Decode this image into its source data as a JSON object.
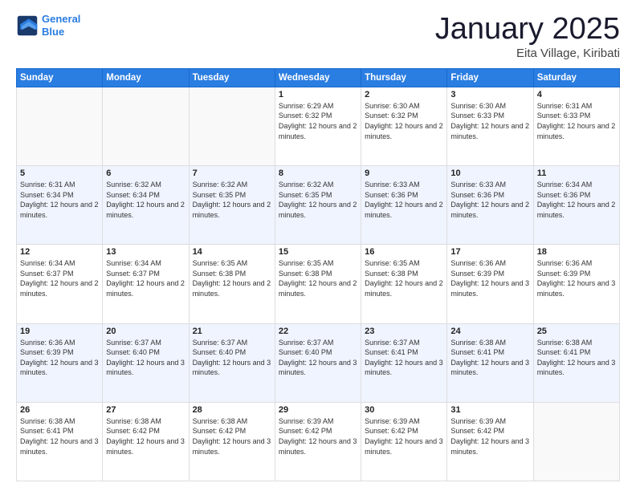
{
  "header": {
    "logo": {
      "line1": "General",
      "line2": "Blue"
    },
    "title": "January 2025",
    "subtitle": "Eita Village, Kiribati"
  },
  "days_of_week": [
    "Sunday",
    "Monday",
    "Tuesday",
    "Wednesday",
    "Thursday",
    "Friday",
    "Saturday"
  ],
  "weeks": [
    [
      {
        "day": "",
        "sunrise": "",
        "sunset": "",
        "daylight": ""
      },
      {
        "day": "",
        "sunrise": "",
        "sunset": "",
        "daylight": ""
      },
      {
        "day": "",
        "sunrise": "",
        "sunset": "",
        "daylight": ""
      },
      {
        "day": "1",
        "sunrise": "Sunrise: 6:29 AM",
        "sunset": "Sunset: 6:32 PM",
        "daylight": "Daylight: 12 hours and 2 minutes."
      },
      {
        "day": "2",
        "sunrise": "Sunrise: 6:30 AM",
        "sunset": "Sunset: 6:32 PM",
        "daylight": "Daylight: 12 hours and 2 minutes."
      },
      {
        "day": "3",
        "sunrise": "Sunrise: 6:30 AM",
        "sunset": "Sunset: 6:33 PM",
        "daylight": "Daylight: 12 hours and 2 minutes."
      },
      {
        "day": "4",
        "sunrise": "Sunrise: 6:31 AM",
        "sunset": "Sunset: 6:33 PM",
        "daylight": "Daylight: 12 hours and 2 minutes."
      }
    ],
    [
      {
        "day": "5",
        "sunrise": "Sunrise: 6:31 AM",
        "sunset": "Sunset: 6:34 PM",
        "daylight": "Daylight: 12 hours and 2 minutes."
      },
      {
        "day": "6",
        "sunrise": "Sunrise: 6:32 AM",
        "sunset": "Sunset: 6:34 PM",
        "daylight": "Daylight: 12 hours and 2 minutes."
      },
      {
        "day": "7",
        "sunrise": "Sunrise: 6:32 AM",
        "sunset": "Sunset: 6:35 PM",
        "daylight": "Daylight: 12 hours and 2 minutes."
      },
      {
        "day": "8",
        "sunrise": "Sunrise: 6:32 AM",
        "sunset": "Sunset: 6:35 PM",
        "daylight": "Daylight: 12 hours and 2 minutes."
      },
      {
        "day": "9",
        "sunrise": "Sunrise: 6:33 AM",
        "sunset": "Sunset: 6:36 PM",
        "daylight": "Daylight: 12 hours and 2 minutes."
      },
      {
        "day": "10",
        "sunrise": "Sunrise: 6:33 AM",
        "sunset": "Sunset: 6:36 PM",
        "daylight": "Daylight: 12 hours and 2 minutes."
      },
      {
        "day": "11",
        "sunrise": "Sunrise: 6:34 AM",
        "sunset": "Sunset: 6:36 PM",
        "daylight": "Daylight: 12 hours and 2 minutes."
      }
    ],
    [
      {
        "day": "12",
        "sunrise": "Sunrise: 6:34 AM",
        "sunset": "Sunset: 6:37 PM",
        "daylight": "Daylight: 12 hours and 2 minutes."
      },
      {
        "day": "13",
        "sunrise": "Sunrise: 6:34 AM",
        "sunset": "Sunset: 6:37 PM",
        "daylight": "Daylight: 12 hours and 2 minutes."
      },
      {
        "day": "14",
        "sunrise": "Sunrise: 6:35 AM",
        "sunset": "Sunset: 6:38 PM",
        "daylight": "Daylight: 12 hours and 2 minutes."
      },
      {
        "day": "15",
        "sunrise": "Sunrise: 6:35 AM",
        "sunset": "Sunset: 6:38 PM",
        "daylight": "Daylight: 12 hours and 2 minutes."
      },
      {
        "day": "16",
        "sunrise": "Sunrise: 6:35 AM",
        "sunset": "Sunset: 6:38 PM",
        "daylight": "Daylight: 12 hours and 2 minutes."
      },
      {
        "day": "17",
        "sunrise": "Sunrise: 6:36 AM",
        "sunset": "Sunset: 6:39 PM",
        "daylight": "Daylight: 12 hours and 3 minutes."
      },
      {
        "day": "18",
        "sunrise": "Sunrise: 6:36 AM",
        "sunset": "Sunset: 6:39 PM",
        "daylight": "Daylight: 12 hours and 3 minutes."
      }
    ],
    [
      {
        "day": "19",
        "sunrise": "Sunrise: 6:36 AM",
        "sunset": "Sunset: 6:39 PM",
        "daylight": "Daylight: 12 hours and 3 minutes."
      },
      {
        "day": "20",
        "sunrise": "Sunrise: 6:37 AM",
        "sunset": "Sunset: 6:40 PM",
        "daylight": "Daylight: 12 hours and 3 minutes."
      },
      {
        "day": "21",
        "sunrise": "Sunrise: 6:37 AM",
        "sunset": "Sunset: 6:40 PM",
        "daylight": "Daylight: 12 hours and 3 minutes."
      },
      {
        "day": "22",
        "sunrise": "Sunrise: 6:37 AM",
        "sunset": "Sunset: 6:40 PM",
        "daylight": "Daylight: 12 hours and 3 minutes."
      },
      {
        "day": "23",
        "sunrise": "Sunrise: 6:37 AM",
        "sunset": "Sunset: 6:41 PM",
        "daylight": "Daylight: 12 hours and 3 minutes."
      },
      {
        "day": "24",
        "sunrise": "Sunrise: 6:38 AM",
        "sunset": "Sunset: 6:41 PM",
        "daylight": "Daylight: 12 hours and 3 minutes."
      },
      {
        "day": "25",
        "sunrise": "Sunrise: 6:38 AM",
        "sunset": "Sunset: 6:41 PM",
        "daylight": "Daylight: 12 hours and 3 minutes."
      }
    ],
    [
      {
        "day": "26",
        "sunrise": "Sunrise: 6:38 AM",
        "sunset": "Sunset: 6:41 PM",
        "daylight": "Daylight: 12 hours and 3 minutes."
      },
      {
        "day": "27",
        "sunrise": "Sunrise: 6:38 AM",
        "sunset": "Sunset: 6:42 PM",
        "daylight": "Daylight: 12 hours and 3 minutes."
      },
      {
        "day": "28",
        "sunrise": "Sunrise: 6:38 AM",
        "sunset": "Sunset: 6:42 PM",
        "daylight": "Daylight: 12 hours and 3 minutes."
      },
      {
        "day": "29",
        "sunrise": "Sunrise: 6:39 AM",
        "sunset": "Sunset: 6:42 PM",
        "daylight": "Daylight: 12 hours and 3 minutes."
      },
      {
        "day": "30",
        "sunrise": "Sunrise: 6:39 AM",
        "sunset": "Sunset: 6:42 PM",
        "daylight": "Daylight: 12 hours and 3 minutes."
      },
      {
        "day": "31",
        "sunrise": "Sunrise: 6:39 AM",
        "sunset": "Sunset: 6:42 PM",
        "daylight": "Daylight: 12 hours and 3 minutes."
      },
      {
        "day": "",
        "sunrise": "",
        "sunset": "",
        "daylight": ""
      }
    ]
  ]
}
